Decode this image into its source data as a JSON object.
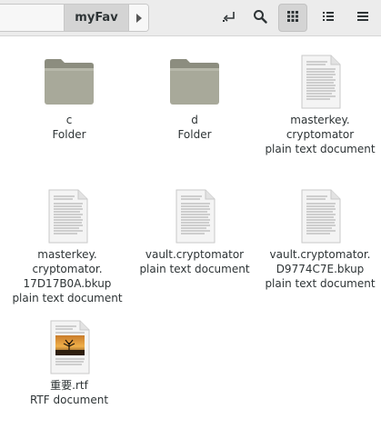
{
  "header": {
    "path_current": "myFav",
    "icons": {
      "next": "chevron-right-icon",
      "new_folder": "undo-arrow-icon",
      "search": "search-icon",
      "grid_view": "grid-view-icon",
      "list_view": "list-view-icon"
    }
  },
  "files": [
    {
      "name": "c",
      "type": "Folder",
      "icon": "folder-icon"
    },
    {
      "name": "d",
      "type": "Folder",
      "icon": "folder-icon"
    },
    {
      "name": "masterkey.\ncryptomator",
      "type": "plain text document",
      "icon": "text-file-icon"
    },
    {
      "name": "masterkey.\ncryptomator.\n17D17B0A.bkup",
      "type": "plain text document",
      "icon": "text-file-icon"
    },
    {
      "name": "vault.cryptomator",
      "type": "plain text document",
      "icon": "text-file-icon"
    },
    {
      "name": "vault.cryptomator.\nD9774C7E.bkup",
      "type": "plain text document",
      "icon": "text-file-icon"
    },
    {
      "name": "重要.rtf",
      "type": "RTF document",
      "icon": "rtf-file-icon"
    }
  ],
  "colors": {
    "folder": "#a8a99a",
    "folder_dark": "#8c8d7f",
    "header_bg": "#ececec",
    "active_button": "#d4d4d4"
  }
}
